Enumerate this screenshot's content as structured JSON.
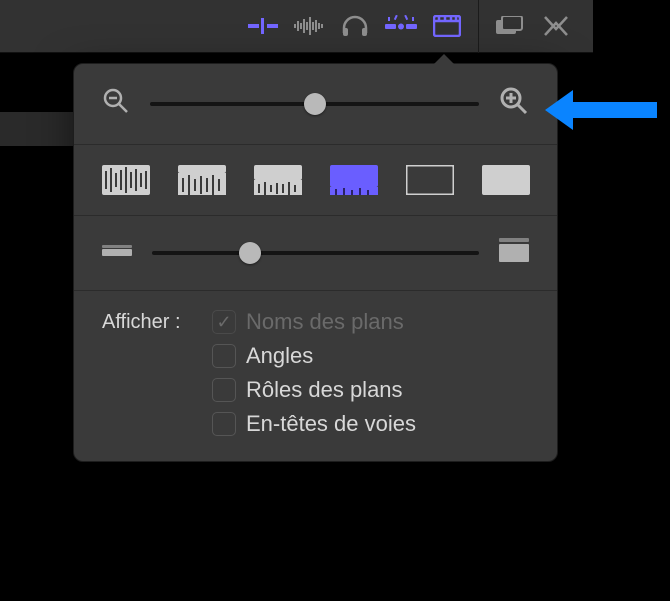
{
  "toolbar": {
    "icons": [
      "skimming",
      "audio-waveform",
      "solo",
      "snapping",
      "clip-appearance",
      "tool-a",
      "tool-b"
    ]
  },
  "clipAppearance": {
    "zoom": {
      "value": 50,
      "min": 0,
      "max": 100
    },
    "clipHeight": {
      "value": 30,
      "min": 0,
      "max": 100
    },
    "showLabel": "Afficher :",
    "options": {
      "clipNames": {
        "label": "Noms des plans",
        "checked": true,
        "disabled": true
      },
      "angles": {
        "label": "Angles",
        "checked": false,
        "disabled": false
      },
      "clipRoles": {
        "label": "Rôles des plans",
        "checked": false,
        "disabled": false
      },
      "laneHeaders": {
        "label": "En-têtes de voies",
        "checked": false,
        "disabled": false
      }
    }
  },
  "annotation": {
    "points_to": "zoom-in-icon"
  }
}
